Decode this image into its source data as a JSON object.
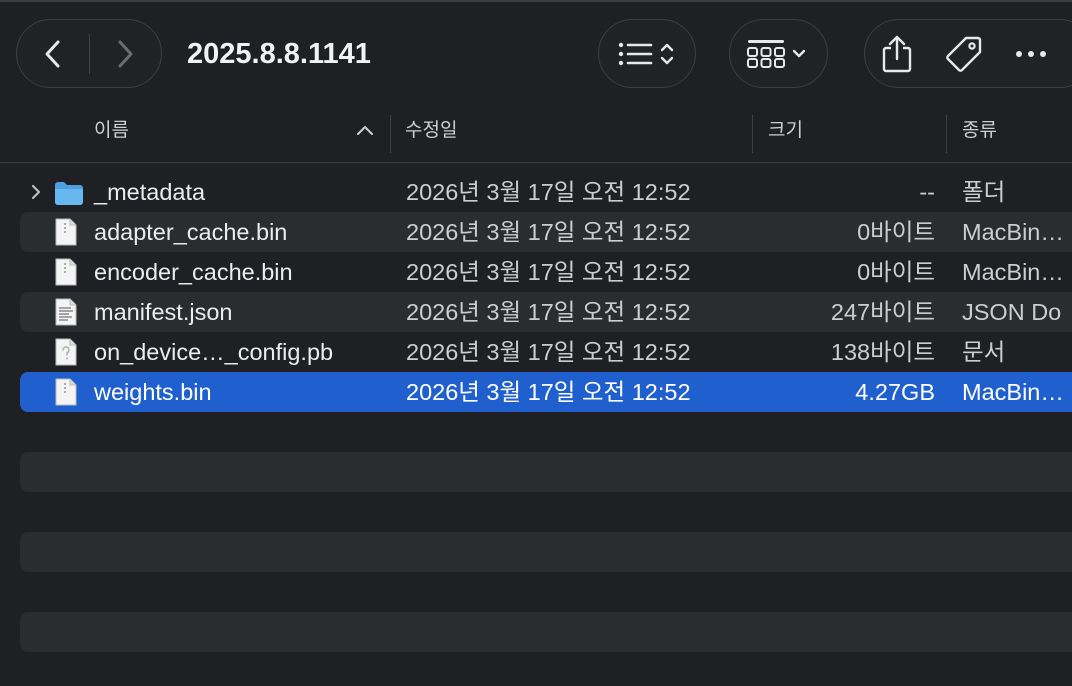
{
  "window": {
    "title": "2025.8.8.1141"
  },
  "toolbar": {
    "back_icon": "chevron-left-icon",
    "forward_icon": "chevron-right-icon",
    "view_list_icon": "list-icon",
    "group_icon": "grid-icon",
    "share_icon": "share-icon",
    "tag_icon": "tag-icon",
    "more_icon": "ellipsis-icon"
  },
  "columns": {
    "name": "이름",
    "modified": "수정일",
    "size": "크기",
    "kind": "종류"
  },
  "files": [
    {
      "name": "_metadata",
      "modified": "2026년 3월 17일 오전 12:52",
      "size": "--",
      "kind": "폴더",
      "icon": "folder-icon"
    },
    {
      "name": "adapter_cache.bin",
      "modified": "2026년 3월 17일 오전 12:52",
      "size": "0바이트",
      "kind": "MacBin…",
      "icon": "binary-file-icon"
    },
    {
      "name": "encoder_cache.bin",
      "modified": "2026년 3월 17일 오전 12:52",
      "size": "0바이트",
      "kind": "MacBin…",
      "icon": "binary-file-icon"
    },
    {
      "name": "manifest.json",
      "modified": "2026년 3월 17일 오전 12:52",
      "size": "247바이트",
      "kind": "JSON Do",
      "icon": "json-file-icon"
    },
    {
      "name": "on_device…_config.pb",
      "modified": "2026년 3월 17일 오전 12:52",
      "size": "138바이트",
      "kind": "문서",
      "icon": "document-file-icon"
    },
    {
      "name": "weights.bin",
      "modified": "2026년 3월 17일 오전 12:52",
      "size": "4.27GB",
      "kind": "MacBin…",
      "icon": "binary-file-icon"
    }
  ],
  "colors": {
    "selection": "#1f5fce",
    "folder": "#5ab0ea",
    "background": "#1e2023"
  }
}
